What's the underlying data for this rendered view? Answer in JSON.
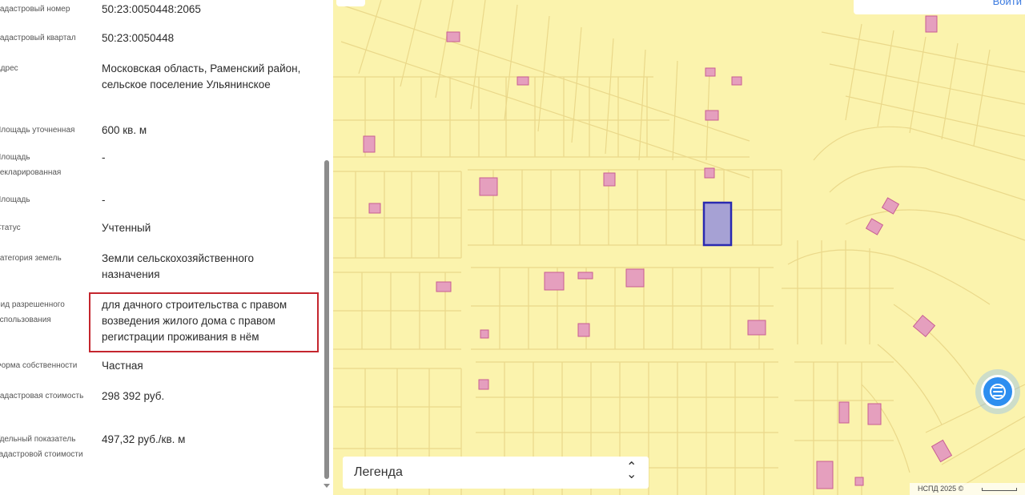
{
  "info": {
    "rows": [
      {
        "label": "Кадастровый номер",
        "value": "50:23:0050448:2065"
      },
      {
        "label": "Кадастровый квартал",
        "value": "50:23:0050448"
      },
      {
        "label": "Адрес",
        "value": "Московская область, Раменский район, сельское поселение Ульянинское"
      },
      {
        "label": "Площадь уточненная",
        "value": "600 кв. м"
      },
      {
        "label": "Площадь декларированная",
        "value": "-"
      },
      {
        "label": "Площадь",
        "value": "-"
      },
      {
        "label": "Статус",
        "value": "Учтенный"
      },
      {
        "label": "Категория земель",
        "value": "Земли сельскохозяйственного назначения"
      },
      {
        "label": "Вид разрешенного использования",
        "value": "для дачного строительства с правом возведения жилого дома с правом регистрации проживания в нём"
      },
      {
        "label": "Форма собственности",
        "value": "Частная"
      },
      {
        "label": "Кадастровая стоимость",
        "value": "298 392 руб."
      },
      {
        "label": "Удельный показатель кадастровой стоимости",
        "value": "497,32 руб./кв. м"
      }
    ]
  },
  "map": {
    "top_link": "Войти",
    "legend_label": "Легенда",
    "legend_arrows_up": "⌃",
    "legend_arrows_down": "⌄",
    "copyright": "НСПД 2025 ©",
    "menu_icon": "menu-list-icon",
    "colors": {
      "map_fill": "#fbf3ad",
      "parcel_line": "#ead88a",
      "building_fill": "#e59fbe",
      "building_stroke": "#c85e93",
      "selected_fill": "#a6a1d4",
      "selected_stroke": "#2a2ab0",
      "highlight": "#c4262e",
      "fab": "#2d8ef0"
    }
  }
}
